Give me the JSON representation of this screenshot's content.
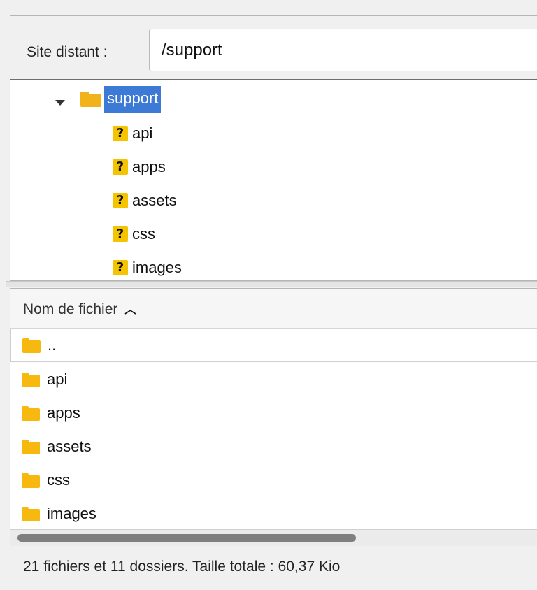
{
  "remote": {
    "label": "Site distant :",
    "path": "/support"
  },
  "tree": {
    "root": "support",
    "children": [
      "api",
      "apps",
      "assets",
      "css",
      "images"
    ]
  },
  "list": {
    "column_header": "Nom de fichier",
    "parent_entry": "..",
    "rows": [
      "api",
      "apps",
      "assets",
      "css",
      "images"
    ]
  },
  "status": "21 fichiers et 11 dossiers. Taille totale : 60,37 Kio",
  "colors": {
    "selection": "#3c7ad6",
    "folder": "#f7b80f",
    "unknown_icon": "#f5c400"
  },
  "icons": {
    "tree_children": "question-mark-icon",
    "list_rows": "folder-icon"
  }
}
